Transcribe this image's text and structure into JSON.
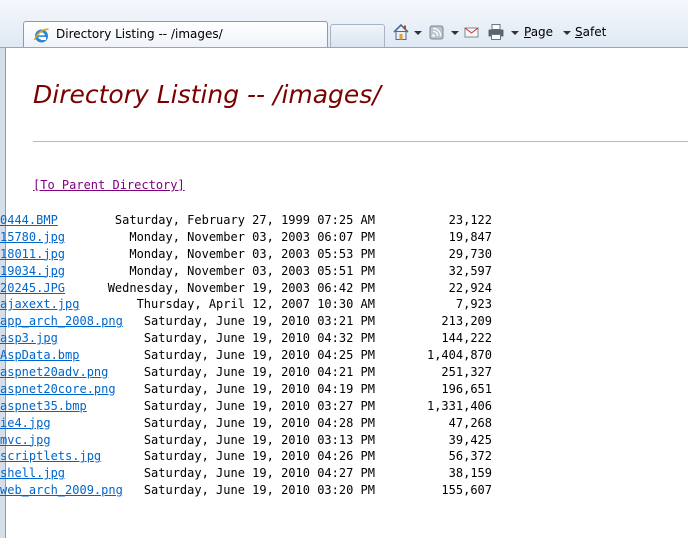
{
  "browser": {
    "tab_title": "Directory Listing -- /images/",
    "page_menu_letter": "P",
    "page_menu_rest": "age",
    "safety_menu_letter": "S",
    "safety_menu_rest": "afet"
  },
  "page": {
    "title": "Directory Listing -- /images/",
    "parent_link": "[To Parent Directory]",
    "files": [
      {
        "date": "Saturday, February 27, 1999 07:25 AM",
        "size": "23,122",
        "name": "0444.BMP"
      },
      {
        "date": "Monday, November 03, 2003 06:07 PM",
        "size": "19,847",
        "name": "15780.jpg"
      },
      {
        "date": "Monday, November 03, 2003 05:53 PM",
        "size": "29,730",
        "name": "18011.jpg"
      },
      {
        "date": "Monday, November 03, 2003 05:51 PM",
        "size": "32,597",
        "name": "19034.jpg"
      },
      {
        "date": "Wednesday, November 19, 2003 06:42 PM",
        "size": "22,924",
        "name": "20245.JPG"
      },
      {
        "date": "Thursday, April 12, 2007 10:30 AM",
        "size": "7,923",
        "name": "ajaxext.jpg"
      },
      {
        "date": "Saturday, June 19, 2010 03:21 PM",
        "size": "213,209",
        "name": "app_arch_2008.png"
      },
      {
        "date": "Saturday, June 19, 2010 04:32 PM",
        "size": "144,222",
        "name": "asp3.jpg"
      },
      {
        "date": "Saturday, June 19, 2010 04:25 PM",
        "size": "1,404,870",
        "name": "AspData.bmp"
      },
      {
        "date": "Saturday, June 19, 2010 04:21 PM",
        "size": "251,327",
        "name": "aspnet20adv.png"
      },
      {
        "date": "Saturday, June 19, 2010 04:19 PM",
        "size": "196,651",
        "name": "aspnet20core.png"
      },
      {
        "date": "Saturday, June 19, 2010 03:27 PM",
        "size": "1,331,406",
        "name": "aspnet35.bmp"
      },
      {
        "date": "Saturday, June 19, 2010 04:28 PM",
        "size": "47,268",
        "name": "ie4.jpg"
      },
      {
        "date": "Saturday, June 19, 2010 03:13 PM",
        "size": "39,425",
        "name": "mvc.jpg"
      },
      {
        "date": "Saturday, June 19, 2010 04:26 PM",
        "size": "56,372",
        "name": "scriptlets.jpg"
      },
      {
        "date": "Saturday, June 19, 2010 04:27 PM",
        "size": "38,159",
        "name": "shell.jpg"
      },
      {
        "date": "Saturday, June 19, 2010 03:20 PM",
        "size": "155,607",
        "name": "web_arch_2009.png"
      }
    ]
  },
  "icons": {
    "tab": "ie-logo-icon",
    "home": "home-icon",
    "feeds": "rss-feed-icon",
    "mail": "read-mail-icon",
    "print": "printer-icon"
  },
  "colors": {
    "title": "#7b0000",
    "link": "#0066cc",
    "visited_link": "#800080"
  }
}
